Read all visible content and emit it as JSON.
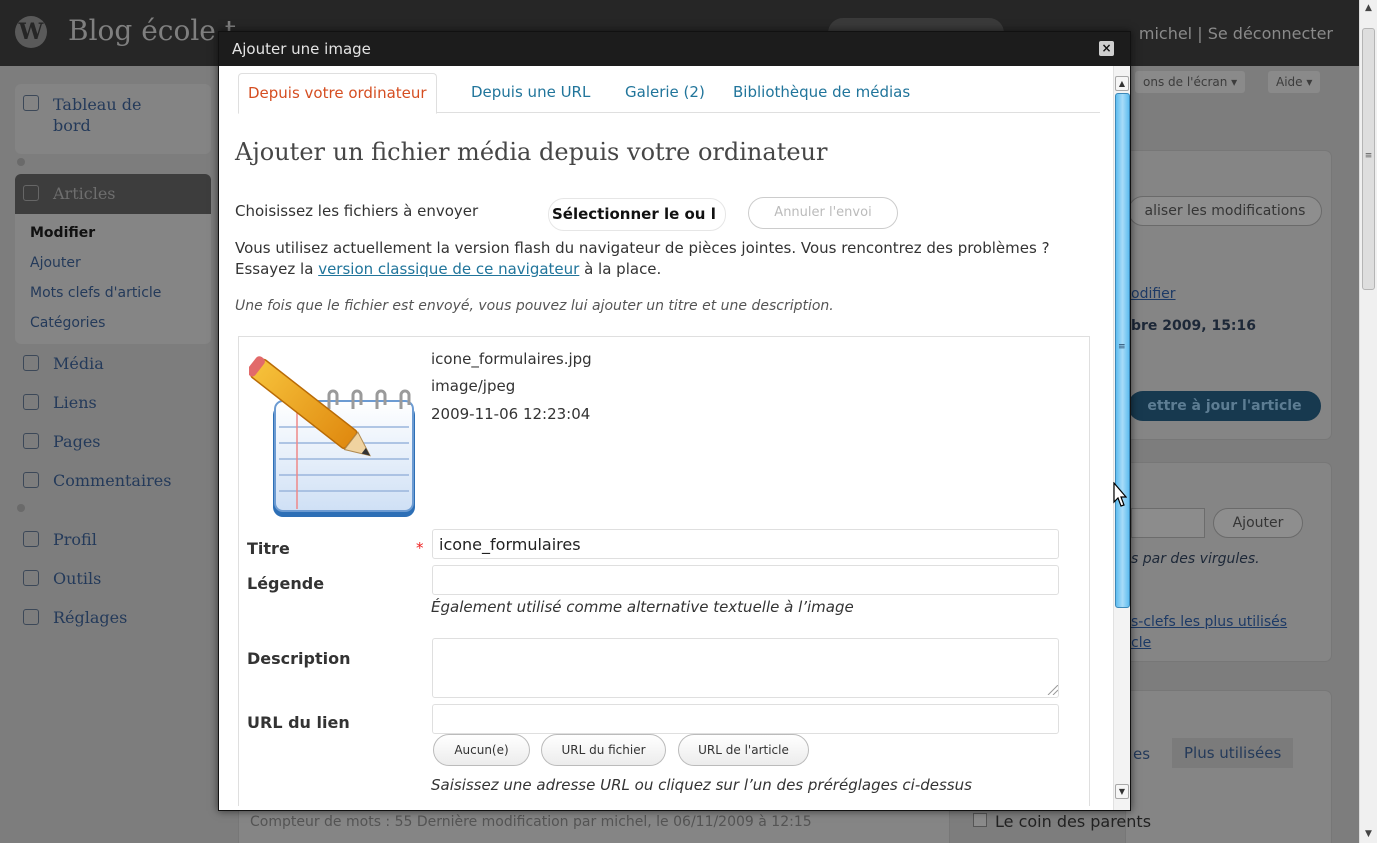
{
  "admin": {
    "site_title": "Blog école t",
    "user_name": "michel",
    "logout": "Se déconnecter",
    "screen_options": "ons de l'écran ▾",
    "help": "Aide ▾",
    "menu": {
      "dashboard": "Tableau de bord",
      "articles": "Articles",
      "articles_sub": [
        "Modifier",
        "Ajouter",
        "Mots clefs d'article",
        "Catégories"
      ],
      "media": "Média",
      "links": "Liens",
      "pages": "Pages",
      "comments": "Commentaires",
      "profile": "Profil",
      "tools": "Outils",
      "settings": "Réglages"
    },
    "right_panel": {
      "save_changes": "aliser les modifications",
      "modify_link": "odifier",
      "date_text": "bre 2009, 15:16",
      "update_btn": "ettre à jour l'article",
      "add_btn": "Ajouter",
      "separate_hint": "s par des virgules.",
      "popular_tags_1": "s-clefs les plus utilisés",
      "popular_tags_2": "cle",
      "tab_most_used": "Plus utilisées",
      "tab_all": "es",
      "category_item": "Le coin des parents"
    },
    "footer_status": "Compteur de mots : 55      Dernière modification par michel, le 06/11/2009 à 12:15"
  },
  "modal": {
    "title": "Ajouter une image",
    "close_label": "×",
    "tabs": [
      {
        "label": "Depuis votre ordinateur",
        "active": true
      },
      {
        "label": "Depuis une URL",
        "active": false
      },
      {
        "label": "Galerie (2)",
        "active": false
      },
      {
        "label": "Bibliothèque de médias",
        "active": false
      }
    ],
    "heading": "Ajouter un fichier média depuis votre ordinateur",
    "choose_label": "Choisissez les fichiers à envoyer",
    "select_button": "Sélectionner le ou l",
    "cancel_upload_button": "Annuler l'envoi",
    "flash_note_start": "Vous utilisez actuellement la version flash du navigateur de pièces jointes. Vous rencontrez des problèmes ? Essayez la ",
    "flash_note_link": "version classique de ce navigateur",
    "flash_note_end": " à la place.",
    "after_note": "Une fois que le fichier est envoyé, vous pouvez lui ajouter un titre et une description.",
    "file": {
      "name": "icone_formulaires.jpg",
      "type": "image/jpeg",
      "date": "2009-11-06 12:23:04"
    },
    "fields": {
      "title_label": "Titre",
      "title_value": "icone_formulaires",
      "required_mark": "*",
      "caption_label": "Légende",
      "caption_value": "",
      "caption_help": "Également utilisé comme alternative textuelle à l’image",
      "description_label": "Description",
      "description_value": "",
      "link_url_label": "URL du lien",
      "link_url_value": "",
      "link_buttons": [
        "Aucun(e)",
        "URL du fichier",
        "URL de l'article"
      ],
      "link_help": "Saisissez une adresse URL ou cliquez sur l’un des préréglages ci-dessus"
    }
  },
  "colors": {
    "accent_link": "#21759b",
    "active_tab": "#d54e21",
    "modal_titlebar": "#1c1c1c"
  },
  "icons": [
    "wordpress-logo-icon",
    "close-icon",
    "pencil-notepad-icon",
    "mouse-cursor-icon"
  ]
}
